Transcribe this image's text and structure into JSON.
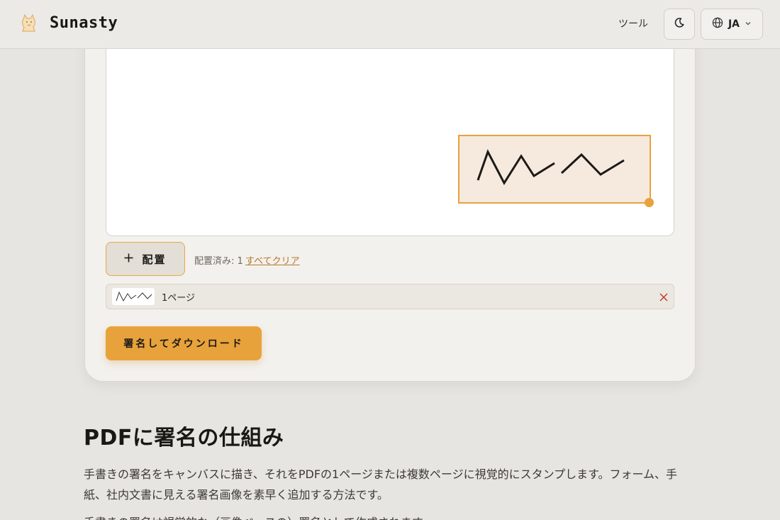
{
  "header": {
    "brand": "Sunasty",
    "nav_tools": "ツール",
    "language": "JA"
  },
  "editor": {
    "place_button": "配置",
    "placed_count": "配置済み: 1",
    "clear_all": "すべてクリア",
    "items": [
      {
        "page_label": "1ページ"
      }
    ],
    "download_button": "署名してダウンロード"
  },
  "content": {
    "title": "PDFに署名の仕組み",
    "paragraph1": "手書きの署名をキャンバスに描き、それをPDFの1ページまたは複数ページに視覚的にスタンプします。フォーム、手紙、社内文書に見える署名画像を素早く追加する方法です。",
    "paragraph2": "手書きの署名は視覚的な（画像ベースの）署名として作成されます。"
  },
  "colors": {
    "accent": "#e8a23c",
    "background": "#e7e5e1",
    "card": "#f3f1ed",
    "remove": "#c0392b"
  },
  "icons": {
    "logo": "cat-logo-icon",
    "theme": "moon-icon",
    "language": "globe-icon",
    "chevron": "chevron-down-icon",
    "place": "plus-icon",
    "remove": "close-icon"
  }
}
